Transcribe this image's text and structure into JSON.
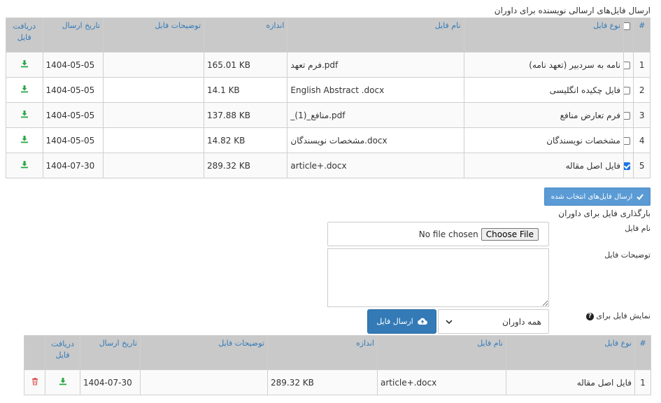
{
  "sent_section": {
    "title": "ارسال فایل‌های ارسالی نویسنده برای داوران",
    "columns": {
      "num": "#",
      "type": "نوع فایل",
      "name": "نام فایل",
      "size": "اندازه",
      "description": "توضیحات فایل",
      "date": "تاریخ ارسال",
      "download": "دریافت فایل"
    },
    "rows": [
      {
        "num": "1",
        "checked": false,
        "type": "نامه به سردبیر (تعهد نامه)",
        "name": "فرم تعهد.pdf",
        "size": "165.01 KB",
        "description": "",
        "date": "1404-05-05"
      },
      {
        "num": "2",
        "checked": false,
        "type": "فایل چکیده انگلیسی",
        "name": "English Abstract .docx",
        "size": "14.1 KB",
        "description": "",
        "date": "1404-05-05"
      },
      {
        "num": "3",
        "checked": false,
        "type": "فرم تعارض منافع",
        "name": "_منافع_(1).pdf",
        "size": "137.88 KB",
        "description": "",
        "date": "1404-05-05"
      },
      {
        "num": "4",
        "checked": false,
        "type": "مشخصات نویسندگان",
        "name": "مشخصات نویسندگان.docx",
        "size": "14.82 KB",
        "description": "",
        "date": "1404-05-05"
      },
      {
        "num": "5",
        "checked": true,
        "type": "فایل اصل مقاله",
        "name": "article+.docx",
        "size": "289.32 KB",
        "description": "",
        "date": "1404-07-30"
      }
    ],
    "send_selected_label": "ارسال فایل‌های انتخاب شده"
  },
  "upload_section": {
    "title": "بارگذاری فایل برای داوران",
    "file_name_label": "نام فایل",
    "choose_file_label": "Choose File",
    "no_file_text": "No file chosen",
    "description_label": "توضیحات فایل",
    "show_for_label": "نمایش فایل برای",
    "select_value": "همه داوران",
    "send_button_label": "ارسال فایل"
  },
  "uploaded_section": {
    "columns": {
      "num": "#",
      "type": "نوع فایل",
      "name": "نام فایل",
      "size": "اندازه",
      "description": "توضیحات فایل",
      "date": "تاریخ ارسال",
      "download": "دریافت فایل"
    },
    "rows": [
      {
        "num": "1",
        "type": "فایل اصل مقاله",
        "name": "article+.docx",
        "size": "289.32 KB",
        "description": "",
        "date": "1404-07-30"
      }
    ]
  },
  "colors": {
    "header_bg": "#c9c9c9",
    "header_text": "#337ab7",
    "download_icon": "#28a745",
    "delete_icon": "#d9534f",
    "primary_button": "#337ab7",
    "light_button": "#5b9bd5"
  },
  "icons": {
    "download": "download-icon",
    "delete": "trash-icon",
    "check": "check-icon",
    "upload": "cloud-upload-icon",
    "help": "question-circle-icon",
    "dropdown": "chevron-down-icon"
  }
}
